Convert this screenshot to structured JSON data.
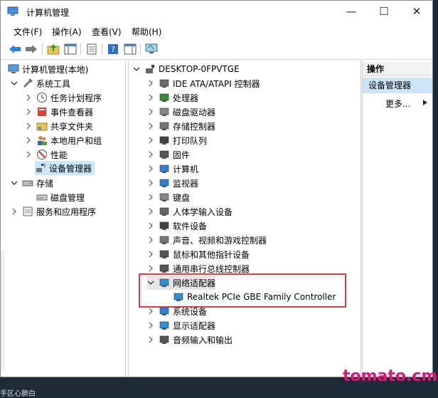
{
  "window": {
    "title": "计算机管理",
    "minimize": "—",
    "maximize": "☐",
    "close": "✕"
  },
  "menu": [
    "文件(F)",
    "操作(A)",
    "查看(V)",
    "帮助(H)"
  ],
  "left_tree": [
    {
      "label": "计算机管理(本地)",
      "icon": "computer-management-icon"
    },
    {
      "label": "系统工具",
      "icon": "tools-icon"
    },
    {
      "label": "任务计划程序",
      "icon": "clock-icon"
    },
    {
      "label": "事件查看器",
      "icon": "event-viewer-icon"
    },
    {
      "label": "共享文件夹",
      "icon": "shared-folder-icon"
    },
    {
      "label": "本地用户和组",
      "icon": "users-icon"
    },
    {
      "label": "性能",
      "icon": "performance-icon"
    },
    {
      "label": "设备管理器",
      "icon": "device-manager-icon"
    },
    {
      "label": "存储",
      "icon": "storage-icon"
    },
    {
      "label": "磁盘管理",
      "icon": "disk-icon"
    },
    {
      "label": "服务和应用程序",
      "icon": "services-icon"
    }
  ],
  "device_tree": {
    "root": "DESKTOP-0FPVTGE",
    "categories": [
      {
        "label": "IDE ATA/ATAPI 控制器",
        "icon": "ide-controller-icon"
      },
      {
        "label": "处理器",
        "icon": "processor-icon"
      },
      {
        "label": "磁盘驱动器",
        "icon": "disk-drive-icon"
      },
      {
        "label": "存储控制器",
        "icon": "storage-controller-icon"
      },
      {
        "label": "打印队列",
        "icon": "printer-icon"
      },
      {
        "label": "固件",
        "icon": "firmware-icon"
      },
      {
        "label": "计算机",
        "icon": "computer-icon"
      },
      {
        "label": "监视器",
        "icon": "monitor-icon"
      },
      {
        "label": "键盘",
        "icon": "keyboard-icon"
      },
      {
        "label": "人体学输入设备",
        "icon": "hid-icon"
      },
      {
        "label": "软件设备",
        "icon": "software-device-icon"
      },
      {
        "label": "声音、视频和游戏控制器",
        "icon": "sound-icon"
      },
      {
        "label": "鼠标和其他指针设备",
        "icon": "mouse-icon"
      },
      {
        "label": "通用串行总线控制器",
        "icon": "usb-icon"
      },
      {
        "label": "网络适配器",
        "icon": "network-adapter-icon"
      },
      {
        "label": "Realtek PCIe GBE Family Controller",
        "icon": "network-adapter-icon"
      },
      {
        "label": "系统设备",
        "icon": "system-device-icon"
      },
      {
        "label": "显示适配器",
        "icon": "display-adapter-icon"
      },
      {
        "label": "音频输入和输出",
        "icon": "audio-icon"
      }
    ]
  },
  "actions": {
    "header": "操作",
    "selected": "设备管理器",
    "more": "更多..."
  },
  "watermark": "tomato.cm",
  "status": "手区心肺白"
}
